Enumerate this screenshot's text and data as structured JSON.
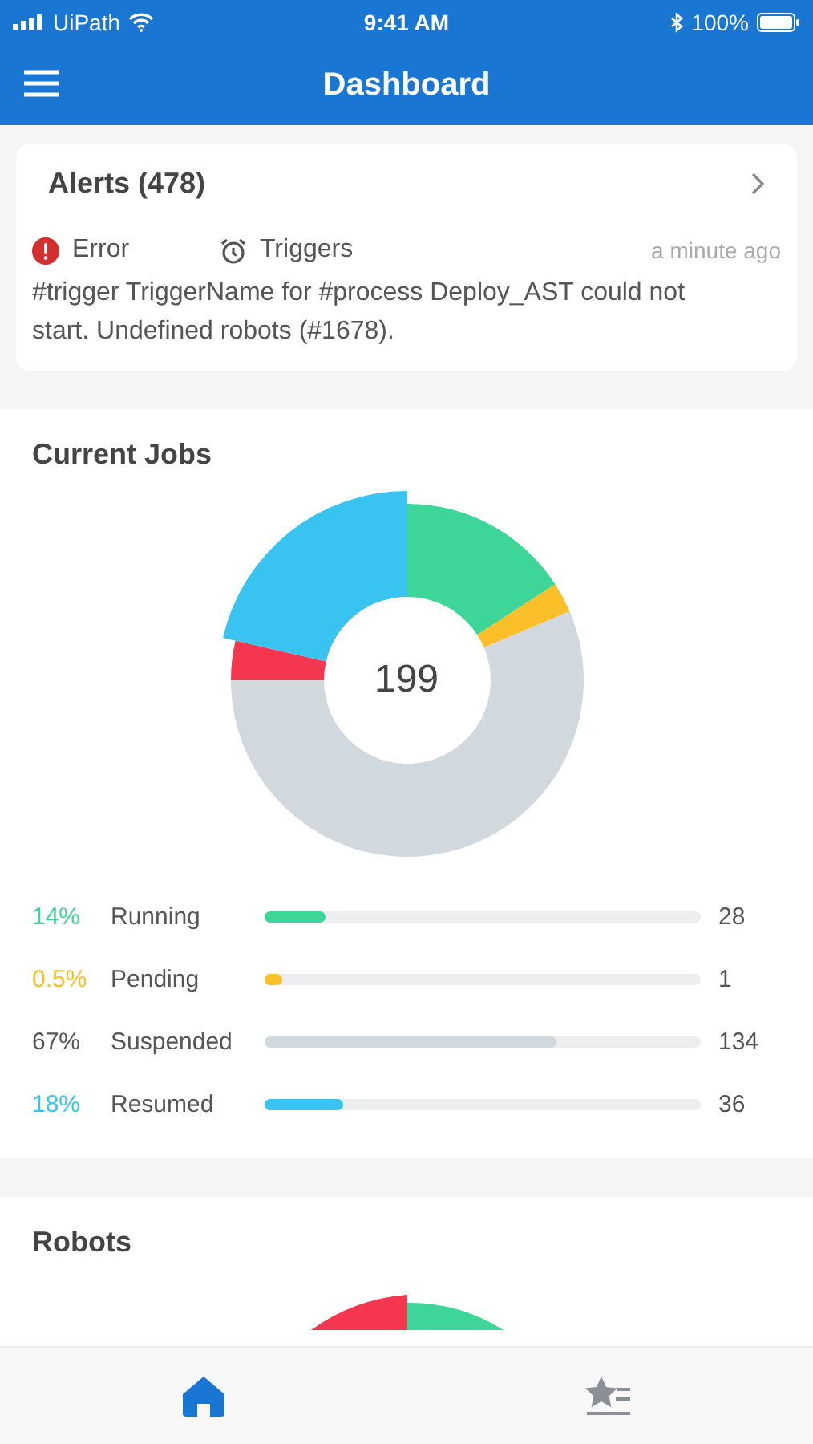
{
  "status_bar": {
    "carrier": "UiPath",
    "time": "9:41 AM",
    "battery": "100%"
  },
  "header": {
    "title": "Dashboard"
  },
  "alerts": {
    "title": "Alerts (478)",
    "severity": "Error",
    "source": "Triggers",
    "time": "a minute ago",
    "message": "#trigger TriggerName for #process Deploy_AST could not start. Undefined robots (#1678)."
  },
  "current_jobs": {
    "title": "Current Jobs",
    "donut_total": "199",
    "rows": [
      {
        "percent": "14%",
        "name": "Running",
        "count": "28",
        "level": 0.14,
        "color": "#3dd598"
      },
      {
        "percent": "0.5%",
        "name": "Pending",
        "count": "1",
        "level": 0.005,
        "color": "#fbbf2a"
      },
      {
        "percent": "67%",
        "name": "Suspended",
        "count": "134",
        "level": 0.67,
        "color": "#d1d9de"
      },
      {
        "percent": "18%",
        "name": "Resumed",
        "count": "36",
        "level": 0.18,
        "color": "#38c3f0"
      }
    ]
  },
  "robots": {
    "title": "Robots"
  },
  "tab_bar": [
    {
      "kind": "home",
      "selected": true
    },
    {
      "kind": "favorites",
      "selected": false
    }
  ]
}
